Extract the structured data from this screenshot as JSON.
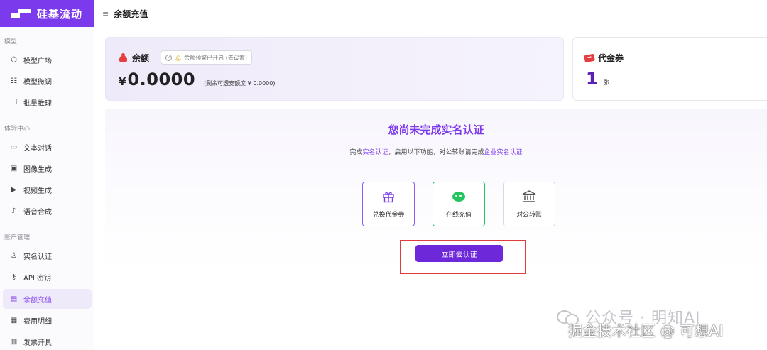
{
  "brand": {
    "name": "硅基流动"
  },
  "header": {
    "title": "余额充值"
  },
  "sidebar": {
    "sections": [
      {
        "title": "模型",
        "items": [
          {
            "label": "模型广场",
            "icon": "cube-icon"
          },
          {
            "label": "模型微调",
            "icon": "sliders-icon"
          },
          {
            "label": "批量推理",
            "icon": "files-icon"
          }
        ]
      },
      {
        "title": "体验中心",
        "items": [
          {
            "label": "文本对话",
            "icon": "chat-icon"
          },
          {
            "label": "图像生成",
            "icon": "image-icon"
          },
          {
            "label": "视频生成",
            "icon": "video-icon"
          },
          {
            "label": "语音合成",
            "icon": "mic-icon"
          }
        ]
      },
      {
        "title": "账户管理",
        "items": [
          {
            "label": "实名认证",
            "icon": "user-check-icon"
          },
          {
            "label": "API 密钥",
            "icon": "key-icon"
          },
          {
            "label": "余额充值",
            "icon": "card-icon",
            "active": true
          },
          {
            "label": "费用明细",
            "icon": "receipt-icon"
          },
          {
            "label": "发票开具",
            "icon": "invoice-icon"
          }
        ]
      }
    ]
  },
  "balance": {
    "label": "余额",
    "alert": "余额预警已开启 (去设置)",
    "currency": "¥",
    "amount": "0.0000",
    "overdraft": "(剩余可透支额度 ¥ 0.0000)"
  },
  "voucher": {
    "label": "代金券",
    "count": "1",
    "unit": "张"
  },
  "verify": {
    "title": "您尚未完成实名认证",
    "desc_prefix": "完成",
    "desc_link1": "实名认证",
    "desc_mid": "，启用以下功能，对公转账请完成",
    "desc_link2": "企业实名认证",
    "options": [
      {
        "label": "兑换代金券",
        "icon": "gift-icon"
      },
      {
        "label": "在线充值",
        "icon": "wechat-icon"
      },
      {
        "label": "对公转账",
        "icon": "bank-icon"
      }
    ],
    "cta": "立即去认证"
  },
  "watermark": {
    "line1": "公众号 · 明知AI",
    "line2": "掘金技术社区 @ 可想AI"
  },
  "colors": {
    "accent": "#7c3aed",
    "highlight": "#e23b3b",
    "wechat": "#22c55e"
  }
}
